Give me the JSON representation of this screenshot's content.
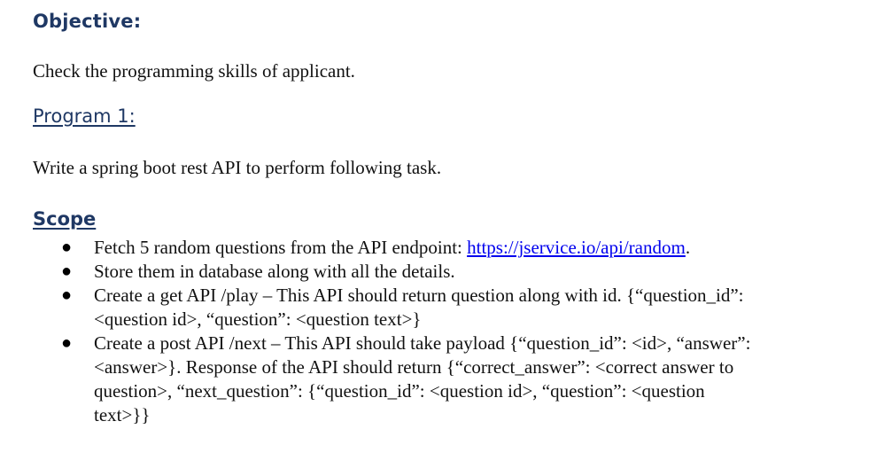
{
  "objective": {
    "title": "Objective:",
    "text": "Check the programming skills of applicant."
  },
  "program": {
    "title": "Program 1:",
    "text": "Write a spring boot rest API to perform following task."
  },
  "scope": {
    "title": "Scope",
    "bullet_symbol": "●",
    "items": [
      {
        "before": "Fetch 5 random questions from the API endpoint: ",
        "link": "https://jservice.io/api/random",
        "after": "."
      },
      {
        "text": "Store them in database along with all the details."
      },
      {
        "text": "Create a get API /play – This API should return question along with id. {“question_id”:\n<question id>, “question”: <question text>}"
      },
      {
        "text": "Create a post API /next – This API should take payload {“question_id”: <id>, “answer”:\n<answer>}. Response of the API should return {“correct_answer”: <correct answer to\nquestion>,  “next_question”:  {“question_id”:  <question  id>,  “question”:  <question\ntext>}}"
      }
    ]
  }
}
